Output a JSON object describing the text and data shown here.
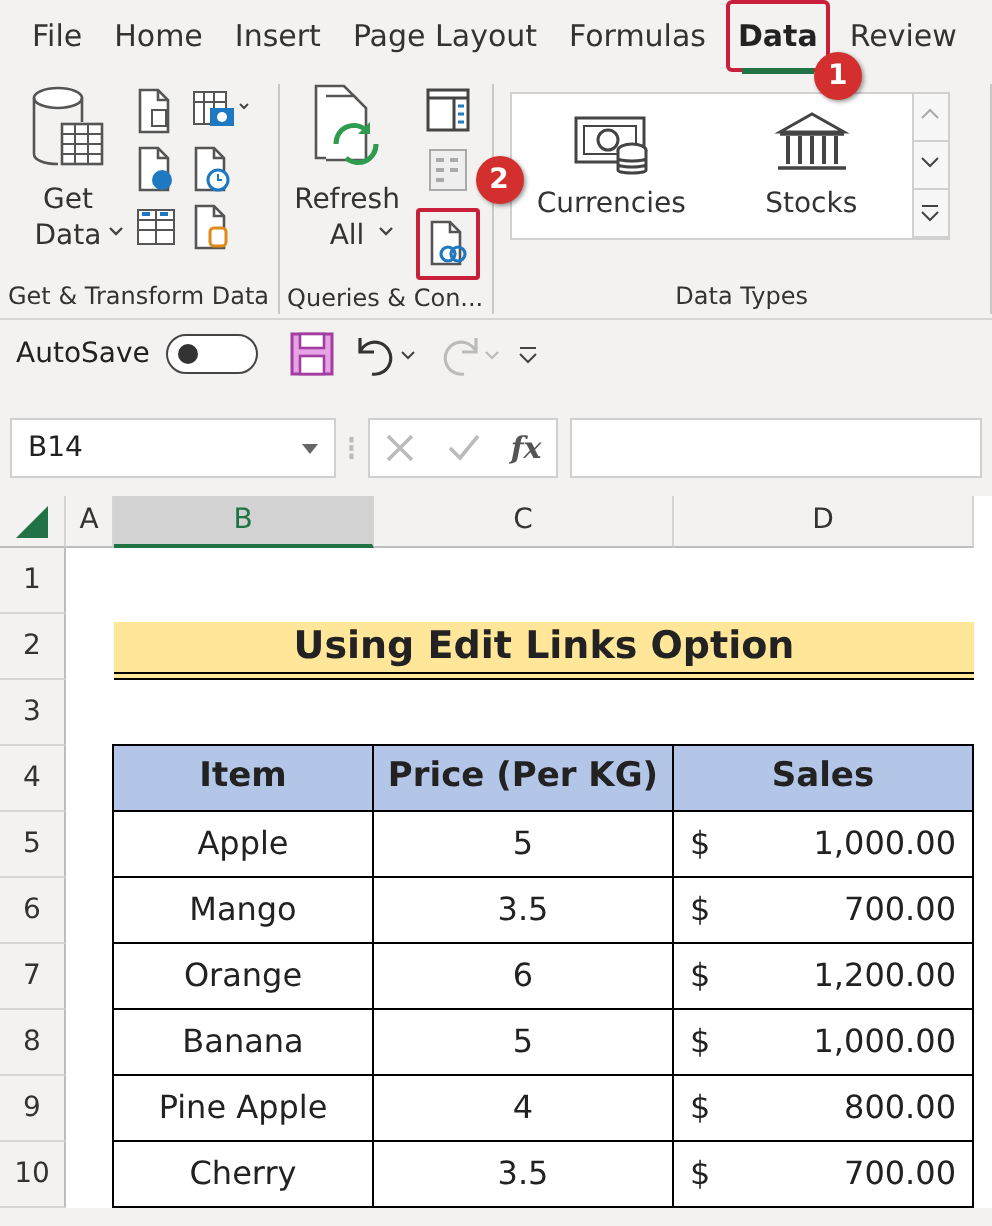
{
  "tabs": [
    {
      "label": "File",
      "selected": false,
      "highlighted": false
    },
    {
      "label": "Home",
      "selected": false,
      "highlighted": false
    },
    {
      "label": "Insert",
      "selected": false,
      "highlighted": false
    },
    {
      "label": "Page Layout",
      "selected": false,
      "highlighted": false
    },
    {
      "label": "Formulas",
      "selected": false,
      "highlighted": false
    },
    {
      "label": "Data",
      "selected": true,
      "highlighted": true,
      "callout": "1"
    },
    {
      "label": "Review",
      "selected": false,
      "highlighted": false
    }
  ],
  "ribbon": {
    "groups": [
      {
        "kind": "get-transform",
        "label": "Get & Transform Data",
        "large_button": {
          "label": "Get Data"
        }
      },
      {
        "kind": "queries",
        "label": "Queries & Con...",
        "large_button": {
          "label": "Refresh All"
        },
        "edit_links": {
          "highlighted": true,
          "callout": "2"
        }
      },
      {
        "kind": "data-types",
        "label": "Data Types",
        "gallery": [
          "Currencies",
          "Stocks"
        ]
      }
    ]
  },
  "quick_access": {
    "autosave": {
      "label": "AutoSave",
      "on": false
    },
    "redo_disabled": true
  },
  "formula_bar": {
    "name_box": "B14",
    "fx": "fx"
  },
  "sheet": {
    "columns": [
      {
        "label": "A",
        "selected": false
      },
      {
        "label": "B",
        "selected": true
      },
      {
        "label": "C",
        "selected": false
      },
      {
        "label": "D",
        "selected": false
      }
    ],
    "row_numbers": [
      "1",
      "2",
      "3",
      "4",
      "5",
      "6",
      "7",
      "8",
      "9",
      "10"
    ],
    "title": "Using Edit Links Option",
    "table": {
      "columns": [
        "Item",
        "Price  (Per KG)",
        "Sales"
      ],
      "rows": [
        [
          "Apple",
          "5",
          {
            "symbol": "$",
            "amount": "1,000.00"
          }
        ],
        [
          "Mango",
          "3.5",
          {
            "symbol": "$",
            "amount": "700.00"
          }
        ],
        [
          "Orange",
          "6",
          {
            "symbol": "$",
            "amount": "1,200.00"
          }
        ],
        [
          "Banana",
          "5",
          {
            "symbol": "$",
            "amount": "1,000.00"
          }
        ],
        [
          "Pine Apple",
          "4",
          {
            "symbol": "$",
            "amount": "800.00"
          }
        ],
        [
          "Cherry",
          "3.5",
          {
            "symbol": "$",
            "amount": "700.00"
          }
        ]
      ]
    }
  }
}
